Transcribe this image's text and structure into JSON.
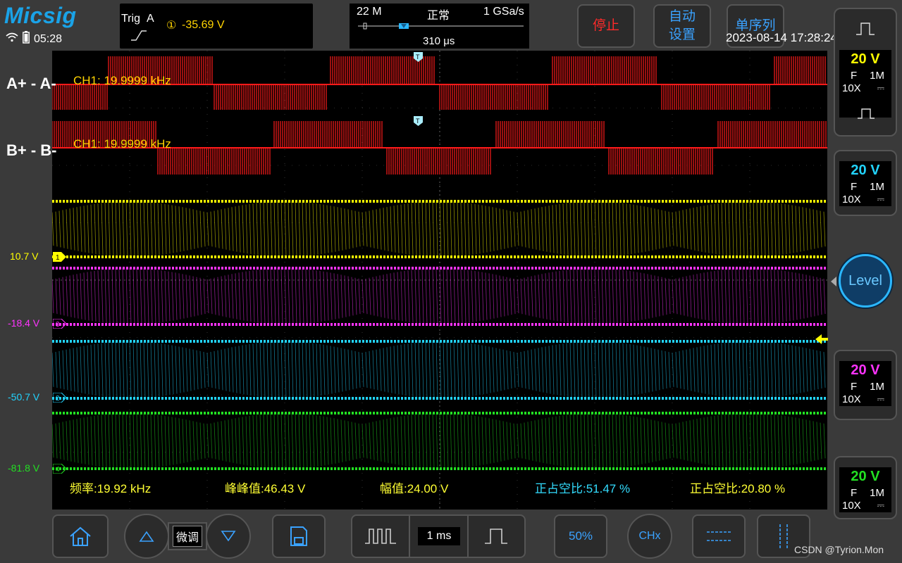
{
  "brand": "Micsig",
  "status": {
    "time": "05:28"
  },
  "trigger": {
    "label": "Trig",
    "source": "A",
    "channel_glyph": "①",
    "value": "-35.69  V"
  },
  "acquisition": {
    "memory": "22 M",
    "mode": "正常",
    "rate": "1 GSa/s",
    "position": "310 μs"
  },
  "top_buttons": {
    "stop": "停止",
    "auto_1": "自动",
    "auto_2": "设置",
    "single": "单序列"
  },
  "datetime": "2023-08-14 17:28:24",
  "ref_labels": {
    "a": "A+ - A-",
    "b": "B+ - B-"
  },
  "freq_readouts": {
    "a": "CH1: 19.9999 kHz",
    "b": "CH1: 19.9999 kHz"
  },
  "channel_offsets": [
    {
      "ch": "1",
      "value": "10.7 V",
      "color": "#ffff00"
    },
    {
      "ch": "3",
      "value": "-18.4 V",
      "color": "#ff33ff"
    },
    {
      "ch": "2",
      "value": "-50.7 V",
      "color": "#22d4ff"
    },
    {
      "ch": "4",
      "value": "-81.8 V",
      "color": "#22e022"
    }
  ],
  "measurements": [
    {
      "text": "频率:19.92 kHz",
      "color": "#ffff33"
    },
    {
      "text": "峰峰值:46.43 V",
      "color": "#ffff33"
    },
    {
      "text": "幅值:24.00 V",
      "color": "#ffff33"
    },
    {
      "text": "正占空比:51.47 %",
      "color": "#33ddff"
    },
    {
      "text": "正占空比:20.80 %",
      "color": "#ffff33"
    }
  ],
  "right_panel": [
    {
      "volts": "20 V",
      "coupling": "F",
      "impedance": "1M",
      "probe": "10X",
      "color": "#ffff00"
    },
    {
      "volts": "20 V",
      "coupling": "F",
      "impedance": "1M",
      "probe": "10X",
      "color": "#22d4ff"
    },
    {
      "volts": "20 V",
      "coupling": "F",
      "impedance": "1M",
      "probe": "10X",
      "color": "#ff33ff"
    },
    {
      "volts": "20 V",
      "coupling": "F",
      "impedance": "1M",
      "probe": "10X",
      "color": "#22e022"
    }
  ],
  "level_button": "Level",
  "bottom": {
    "fine": "微调",
    "timebase": "1 ms",
    "fifty": "50%",
    "chx": "CHx"
  },
  "watermark": "CSDN @Tyrion.Mon"
}
